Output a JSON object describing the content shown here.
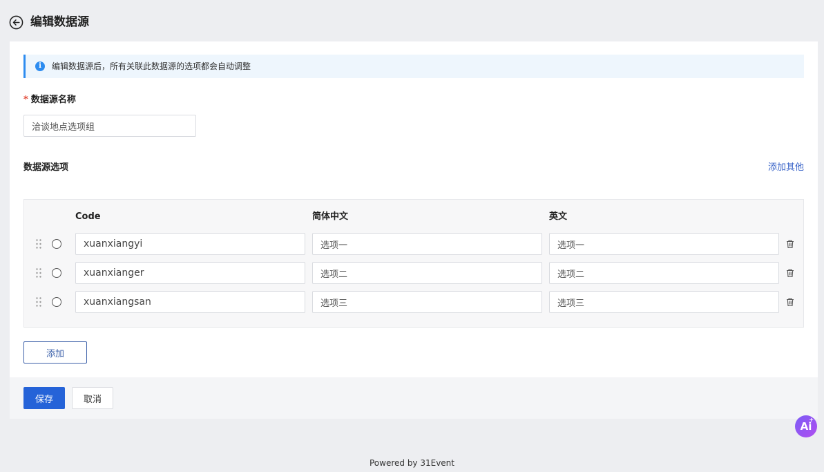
{
  "header": {
    "title": "编辑数据源",
    "back_icon": "arrow-left-circle-icon"
  },
  "notice": {
    "icon": "info-icon",
    "text": "编辑数据源后，所有关联此数据源的选项都会自动调整"
  },
  "form": {
    "name_label": "数据源名称",
    "required_mark": "*",
    "name_value": "洽谈地点选项组"
  },
  "options_section": {
    "title": "数据源选项",
    "add_other_label": "添加其他",
    "columns": [
      "Code",
      "简体中文",
      "英文"
    ],
    "rows": [
      {
        "code": "xuanxiangyi",
        "zh": "选项一",
        "en": "选项一"
      },
      {
        "code": "xuanxianger",
        "zh": "选项二",
        "en": "选项二"
      },
      {
        "code": "xuanxiangsan",
        "zh": "选项三",
        "en": "选项三"
      }
    ],
    "add_label": "添加"
  },
  "footer": {
    "save_label": "保存",
    "cancel_label": "取消"
  },
  "ai_button": {
    "label": "Ai",
    "spark": "+"
  },
  "powered_by": "Powered by 31Event",
  "colors": {
    "accent": "#2563d8",
    "link": "#3a64c8",
    "info": "#2d8cf0",
    "required": "#e34d3b"
  }
}
